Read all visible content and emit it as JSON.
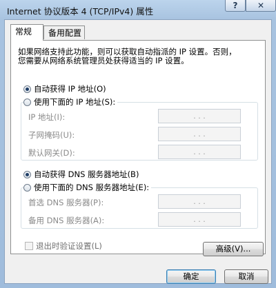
{
  "window": {
    "title": "Internet 协议版本 4 (TCP/IPv4) 属性",
    "help_label": "?",
    "close_label": "✕"
  },
  "tabs": [
    {
      "label": "常规",
      "active": true
    },
    {
      "label": "备用配置",
      "active": false
    }
  ],
  "description": {
    "line1": "如果网络支持此功能，则可以获取自动指派的 IP 设置。否则，",
    "line2": "您需要从网络系统管理员处获得适当的 IP 设置。"
  },
  "ip_section": {
    "auto_option": {
      "label": "自动获得 IP 地址(O)",
      "selected": true
    },
    "manual_option": {
      "label": "使用下面的 IP 地址(S):",
      "selected": false
    },
    "fields": [
      {
        "label": "IP 地址(I):",
        "value": ". . ."
      },
      {
        "label": "子网掩码(U):",
        "value": ". . ."
      },
      {
        "label": "默认网关(D):",
        "value": ". . ."
      }
    ]
  },
  "dns_section": {
    "auto_option": {
      "label": "自动获得 DNS 服务器地址(B)",
      "selected": true
    },
    "manual_option": {
      "label": "使用下面的 DNS 服务器地址(E):",
      "selected": false
    },
    "fields": [
      {
        "label": "首选 DNS 服务器(P):",
        "value": ". . ."
      },
      {
        "label": "备用 DNS 服务器(A):",
        "value": ". . ."
      }
    ]
  },
  "validate_checkbox": {
    "label": "退出时验证设置(L)",
    "checked": false
  },
  "buttons": {
    "advanced": "高级(V)...",
    "ok": "确定",
    "cancel": "取消"
  }
}
